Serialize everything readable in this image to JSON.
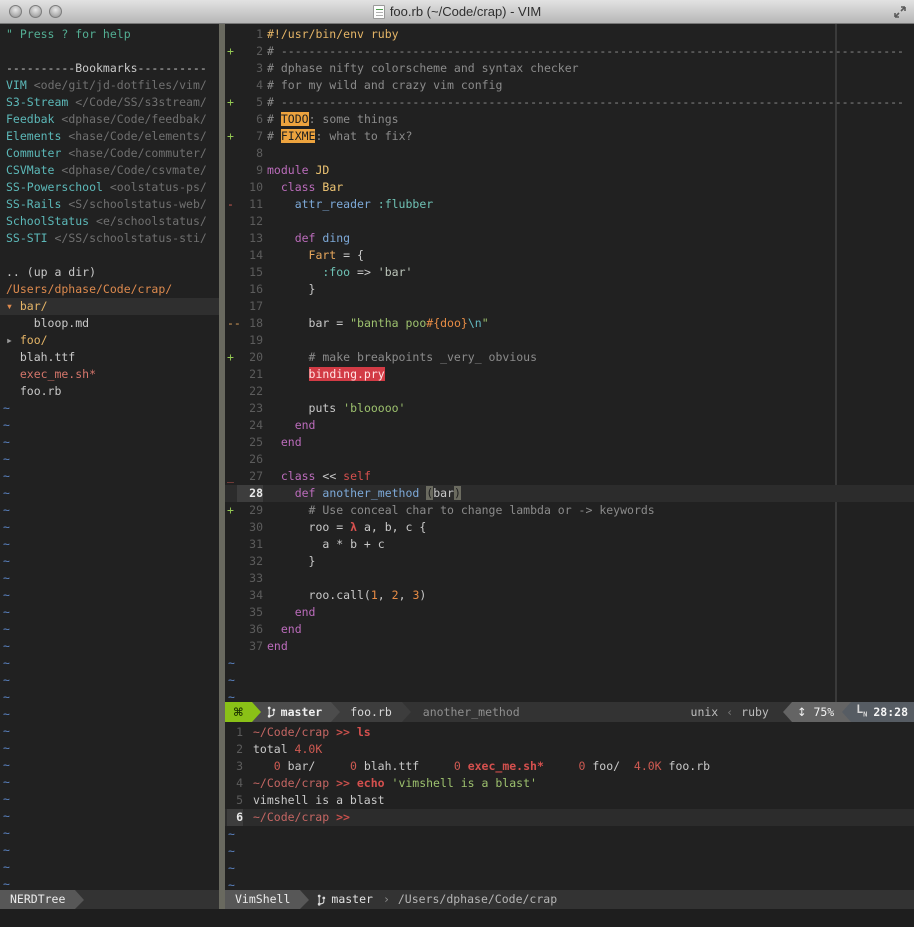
{
  "colors": {
    "background": "#212121",
    "accent_green": "#8ac117",
    "keyword": "#bb6cbb",
    "string": "#9dc16e",
    "constant": "#f0c674",
    "function": "#7da9d8",
    "todo_bg": "#eda33e",
    "pry_bg": "#d23b45",
    "tilde": "#5b84c4",
    "dir": "#e5b567"
  },
  "window": {
    "title": "foo.rb (~/Code/crap) - VIM"
  },
  "nerdtree": {
    "rows": [
      {
        "kind": "help",
        "text": "\" Press ? for help"
      },
      {
        "kind": "blank"
      },
      {
        "kind": "header",
        "text": "----------Bookmarks----------"
      },
      {
        "kind": "bookmark",
        "name": "VIM",
        "path": "<ode/git/jd-dotfiles/vim/"
      },
      {
        "kind": "bookmark",
        "name": "S3-Stream",
        "path": "</Code/SS/s3stream/"
      },
      {
        "kind": "bookmark",
        "name": "Feedbak",
        "path": "<dphase/Code/feedbak/"
      },
      {
        "kind": "bookmark",
        "name": "Elements",
        "path": "<hase/Code/elements/"
      },
      {
        "kind": "bookmark",
        "name": "Commuter",
        "path": "<hase/Code/commuter/"
      },
      {
        "kind": "bookmark",
        "name": "CSVMate",
        "path": "<dphase/Code/csvmate/"
      },
      {
        "kind": "bookmark",
        "name": "SS-Powerschool",
        "path": "<oolstatus-ps/"
      },
      {
        "kind": "bookmark",
        "name": "SS-Rails",
        "path": "<S/schoolstatus-web/"
      },
      {
        "kind": "bookmark",
        "name": "SchoolStatus",
        "path": "<e/schoolstatus/"
      },
      {
        "kind": "bookmark",
        "name": "SS-STI",
        "path": "</SS/schoolstatus-sti/"
      },
      {
        "kind": "blank"
      },
      {
        "kind": "plain",
        "text": ".. (up a dir)"
      },
      {
        "kind": "root",
        "text": "/Users/dphase/Code/crap/"
      },
      {
        "kind": "dir",
        "arrow": "▾",
        "state": "open",
        "text": "bar/",
        "selected": true
      },
      {
        "kind": "plain",
        "text": "    bloop.md"
      },
      {
        "kind": "dir",
        "arrow": "▸",
        "state": "closed",
        "text": "foo/"
      },
      {
        "kind": "plain",
        "text": "  blah.ttf"
      },
      {
        "kind": "exec",
        "text": "  exec_me.sh*"
      },
      {
        "kind": "plain",
        "text": "  foo.rb"
      }
    ],
    "tilde": "~",
    "tilde_count": 29,
    "statusline_label": "NERDTree"
  },
  "editor": {
    "lines": [
      {
        "n": 1,
        "segs": [
          [
            "sheb",
            "#!/usr/bin/env ruby"
          ]
        ]
      },
      {
        "n": 2,
        "sign": "+",
        "signc": "sgreen",
        "segs": [
          [
            "com",
            "# ------------------------------------------------------------------------------------------"
          ]
        ]
      },
      {
        "n": 3,
        "segs": [
          [
            "com",
            "# dphase nifty colorscheme and syntax checker"
          ]
        ]
      },
      {
        "n": 4,
        "segs": [
          [
            "com",
            "# for my wild and crazy vim config"
          ]
        ]
      },
      {
        "n": 5,
        "sign": "+",
        "signc": "sgreen",
        "segs": [
          [
            "com",
            "# ------------------------------------------------------------------------------------------"
          ]
        ]
      },
      {
        "n": 6,
        "segs": [
          [
            "com",
            "# "
          ],
          [
            "todo",
            "TODO"
          ],
          [
            "com",
            ": some things"
          ]
        ]
      },
      {
        "n": 7,
        "sign": "+",
        "signc": "sgreen",
        "segs": [
          [
            "com",
            "# "
          ],
          [
            "todo",
            "FIXME"
          ],
          [
            "com",
            ": what to fix?"
          ]
        ]
      },
      {
        "n": 8,
        "segs": []
      },
      {
        "n": 9,
        "segs": [
          [
            "kw",
            "module"
          ],
          [
            "const",
            " JD"
          ]
        ]
      },
      {
        "n": 10,
        "segs": [
          [
            "kw",
            "  class"
          ],
          [
            "const",
            " Bar"
          ]
        ]
      },
      {
        "n": 11,
        "sign": "-",
        "signc": "sred",
        "segs": [
          [
            "fn",
            "    attr_reader"
          ],
          [
            "sym",
            " :flubber"
          ]
        ]
      },
      {
        "n": 12,
        "segs": []
      },
      {
        "n": 13,
        "segs": [
          [
            "kw",
            "    def"
          ],
          [
            "fn",
            " ding"
          ]
        ]
      },
      {
        "n": 14,
        "segs": [
          [
            "constO",
            "      Fart"
          ],
          [
            "pun",
            " = {"
          ]
        ]
      },
      {
        "n": 15,
        "segs": [
          [
            "sym",
            "        :foo"
          ],
          [
            "pun",
            " => "
          ],
          [
            "strd",
            "'bar'"
          ]
        ]
      },
      {
        "n": 16,
        "segs": [
          [
            "pun",
            "      }"
          ]
        ]
      },
      {
        "n": 17,
        "segs": []
      },
      {
        "n": 18,
        "sign": "--",
        "signc": "sorange",
        "segs": [
          [
            "id",
            "      bar "
          ],
          [
            "pun",
            "= "
          ],
          [
            "str",
            "\"bantha poo"
          ],
          [
            "interp",
            "#{doo}"
          ],
          [
            "esc",
            "\\n"
          ],
          [
            "str",
            "\""
          ]
        ]
      },
      {
        "n": 19,
        "segs": []
      },
      {
        "n": 20,
        "sign": "+",
        "signc": "sgreen",
        "segs": [
          [
            "com",
            "      # make breakpoints _very_ obvious"
          ]
        ]
      },
      {
        "n": 21,
        "segs": [
          [
            "id",
            "      "
          ],
          [
            "pry",
            "binding.pry"
          ]
        ]
      },
      {
        "n": 22,
        "segs": []
      },
      {
        "n": 23,
        "segs": [
          [
            "id",
            "      puts "
          ],
          [
            "str",
            "'blooooo'"
          ]
        ]
      },
      {
        "n": 24,
        "segs": [
          [
            "kw",
            "    end"
          ]
        ]
      },
      {
        "n": 25,
        "segs": [
          [
            "kw",
            "  end"
          ]
        ]
      },
      {
        "n": 26,
        "segs": []
      },
      {
        "n": 27,
        "sign": "_",
        "signc": "sred",
        "segs": [
          [
            "kw",
            "  class"
          ],
          [
            "pun",
            " << "
          ],
          [
            "self",
            "self"
          ]
        ]
      },
      {
        "n": 28,
        "cursor": true,
        "segs": [
          [
            "kw",
            "    def"
          ],
          [
            "fn",
            " another_method"
          ],
          [
            "id",
            " "
          ],
          [
            "paren",
            "("
          ],
          [
            "id",
            "bar"
          ],
          [
            "paren",
            ")"
          ]
        ]
      },
      {
        "n": 29,
        "sign": "+",
        "signc": "sgreen",
        "segs": [
          [
            "com",
            "      # Use conceal char to change lambda or -> keywords"
          ]
        ]
      },
      {
        "n": 30,
        "segs": [
          [
            "id",
            "      roo "
          ],
          [
            "pun",
            "= "
          ],
          [
            "lam",
            "λ"
          ],
          [
            "id",
            " a, b, c {"
          ]
        ]
      },
      {
        "n": 31,
        "segs": [
          [
            "id",
            "        a * b + c"
          ]
        ]
      },
      {
        "n": 32,
        "segs": [
          [
            "pun",
            "      }"
          ]
        ]
      },
      {
        "n": 33,
        "segs": []
      },
      {
        "n": 34,
        "segs": [
          [
            "id",
            "      roo.call("
          ],
          [
            "num",
            "1"
          ],
          [
            "id",
            ", "
          ],
          [
            "num",
            "2"
          ],
          [
            "id",
            ", "
          ],
          [
            "num",
            "3"
          ],
          [
            "id",
            ")"
          ]
        ]
      },
      {
        "n": 35,
        "segs": [
          [
            "kw",
            "    end"
          ]
        ]
      },
      {
        "n": 36,
        "segs": [
          [
            "kw",
            "  end"
          ]
        ]
      },
      {
        "n": 37,
        "segs": [
          [
            "kw",
            "end"
          ]
        ]
      }
    ],
    "tilde": "~",
    "tilde_count": 3
  },
  "statusline": {
    "mode_symbol": "⌘",
    "branch": "master",
    "file": "foo.rb",
    "context": "another_method",
    "fileformat": "unix",
    "separator": "‹",
    "filetype": "ruby",
    "scroll_icon": "↕",
    "scroll": "75%",
    "position": "28:28"
  },
  "vimshell": {
    "lines": [
      {
        "n": 1,
        "segs": [
          [
            "prompt",
            "~/Code/crap "
          ],
          [
            "pgt",
            ">> "
          ],
          [
            "cmd",
            "ls"
          ]
        ]
      },
      {
        "n": 2,
        "segs": [
          [
            "plain",
            "total "
          ],
          [
            "snum",
            "4.0K"
          ]
        ]
      },
      {
        "n": 3,
        "segs": [
          [
            "plain",
            "   "
          ],
          [
            "snum",
            "0"
          ],
          [
            "plain",
            " bar/     "
          ],
          [
            "snum",
            "0"
          ],
          [
            "plain",
            " blah.ttf     "
          ],
          [
            "snum",
            "0"
          ],
          [
            "sexec",
            " exec_me.sh*"
          ],
          [
            "plain",
            "     "
          ],
          [
            "snum",
            "0"
          ],
          [
            "plain",
            " foo/  "
          ],
          [
            "snum",
            "4.0K"
          ],
          [
            "plain",
            " foo.rb"
          ]
        ]
      },
      {
        "n": 4,
        "segs": [
          [
            "prompt",
            "~/Code/crap "
          ],
          [
            "pgt",
            ">> "
          ],
          [
            "cmd",
            "echo"
          ],
          [
            "plain",
            " "
          ],
          [
            "pstr",
            "'vimshell is a blast'"
          ]
        ]
      },
      {
        "n": 5,
        "segs": [
          [
            "plain",
            "vimshell is a blast"
          ]
        ]
      },
      {
        "n": 6,
        "cursor": true,
        "segs": [
          [
            "prompt",
            "~/Code/crap "
          ],
          [
            "pgt",
            ">>"
          ]
        ]
      }
    ],
    "tilde": "~",
    "tilde_count": 4,
    "statusline": {
      "label": "VimShell",
      "branch": "master",
      "separator": "›",
      "path": "/Users/dphase/Code/crap"
    }
  }
}
